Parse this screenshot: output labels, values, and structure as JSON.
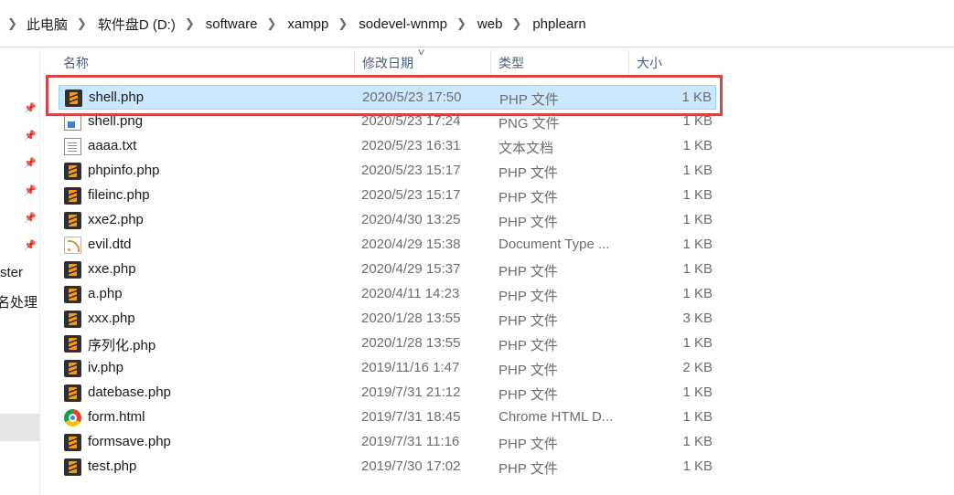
{
  "breadcrumb": [
    "此电脑",
    "软件盘D (D:)",
    "software",
    "xampp",
    "sodevel-wnmp",
    "web",
    "phplearn"
  ],
  "nav": {
    "partial_items": [
      "ster",
      "名处理"
    ]
  },
  "columns": {
    "name": "名称",
    "date": "修改日期",
    "type": "类型",
    "size": "大小"
  },
  "files": [
    {
      "name": "shell.php",
      "date": "2020/5/23 17:50",
      "type": "PHP 文件",
      "size": "1 KB",
      "icon": "sublime-php-icon",
      "selected": true
    },
    {
      "name": "shell.png",
      "date": "2020/5/23 17:24",
      "type": "PNG 文件",
      "size": "1 KB",
      "icon": "png-image-icon"
    },
    {
      "name": "aaaa.txt",
      "date": "2020/5/23 16:31",
      "type": "文本文档",
      "size": "1 KB",
      "icon": "text-document-icon"
    },
    {
      "name": "phpinfo.php",
      "date": "2020/5/23 15:17",
      "type": "PHP 文件",
      "size": "1 KB",
      "icon": "sublime-php-icon"
    },
    {
      "name": "fileinc.php",
      "date": "2020/5/23 15:17",
      "type": "PHP 文件",
      "size": "1 KB",
      "icon": "sublime-php-icon"
    },
    {
      "name": "xxe2.php",
      "date": "2020/4/30 13:25",
      "type": "PHP 文件",
      "size": "1 KB",
      "icon": "sublime-php-icon"
    },
    {
      "name": "evil.dtd",
      "date": "2020/4/29 15:38",
      "type": "Document Type ...",
      "size": "1 KB",
      "icon": "rss-document-icon"
    },
    {
      "name": "xxe.php",
      "date": "2020/4/29 15:37",
      "type": "PHP 文件",
      "size": "1 KB",
      "icon": "sublime-php-icon"
    },
    {
      "name": "a.php",
      "date": "2020/4/11 14:23",
      "type": "PHP 文件",
      "size": "1 KB",
      "icon": "sublime-php-icon"
    },
    {
      "name": "xxx.php",
      "date": "2020/1/28 13:55",
      "type": "PHP 文件",
      "size": "3 KB",
      "icon": "sublime-php-icon"
    },
    {
      "name": "序列化.php",
      "date": "2020/1/28 13:55",
      "type": "PHP 文件",
      "size": "1 KB",
      "icon": "sublime-php-icon"
    },
    {
      "name": "iv.php",
      "date": "2019/11/16 1:47",
      "type": "PHP 文件",
      "size": "2 KB",
      "icon": "sublime-php-icon"
    },
    {
      "name": "datebase.php",
      "date": "2019/7/31 21:12",
      "type": "PHP 文件",
      "size": "1 KB",
      "icon": "sublime-php-icon"
    },
    {
      "name": "form.html",
      "date": "2019/7/31 18:45",
      "type": "Chrome HTML D...",
      "size": "1 KB",
      "icon": "chrome-html-icon"
    },
    {
      "name": "formsave.php",
      "date": "2019/7/31 11:16",
      "type": "PHP 文件",
      "size": "1 KB",
      "icon": "sublime-php-icon"
    },
    {
      "name": "test.php",
      "date": "2019/7/30 17:02",
      "type": "PHP 文件",
      "size": "1 KB",
      "icon": "sublime-php-icon"
    }
  ],
  "colors": {
    "selection_bg": "#cce8ff",
    "selection_border": "#99d1ff",
    "highlight_box": "#d64545",
    "header_text": "#4c607a"
  }
}
